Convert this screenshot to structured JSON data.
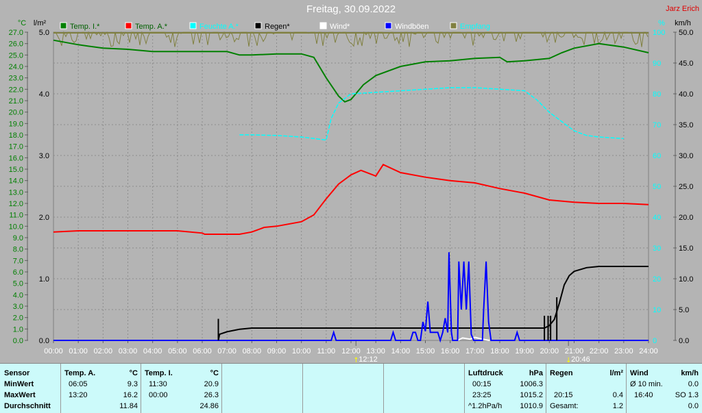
{
  "title": "Freitag, 30.09.2022",
  "author": "Jarz Erich",
  "chart_data": {
    "type": "line",
    "title": "Freitag, 30.09.2022",
    "axes": {
      "left_unit": "°C",
      "left_range": [
        0,
        27
      ],
      "left_ticks": [
        "0.0",
        "1.0",
        "2.0",
        "3.0",
        "4.0",
        "5.0",
        "6.0",
        "7.0",
        "8.0",
        "9.0",
        "10.0",
        "11.0",
        "12.0",
        "13.0",
        "14.0",
        "15.0",
        "16.0",
        "17.0",
        "18.0",
        "19.0",
        "20.0",
        "21.0",
        "22.0",
        "23.0",
        "24.0",
        "25.0",
        "26.0",
        "27.0"
      ],
      "rain_unit": "l/m²",
      "rain_range": [
        0,
        5
      ],
      "rain_ticks": [
        "0.0",
        "1.0",
        "2.0",
        "3.0",
        "4.0",
        "5.0"
      ],
      "pct_unit": "%",
      "pct_range": [
        0,
        100
      ],
      "pct_ticks": [
        "0",
        "10",
        "20",
        "30",
        "40",
        "50",
        "60",
        "70",
        "80",
        "90",
        "100"
      ],
      "wind_unit": "km/h",
      "wind_range": [
        0,
        50
      ],
      "wind_ticks": [
        "0.0",
        "5.0",
        "10.0",
        "15.0",
        "20.0",
        "25.0",
        "30.0",
        "35.0",
        "40.0",
        "45.0",
        "50.0"
      ],
      "x_ticks": [
        "00:00",
        "01:00",
        "02:00",
        "03:00",
        "04:00",
        "05:00",
        "06:00",
        "07:00",
        "08:00",
        "09:00",
        "10:00",
        "11:00",
        "12:00",
        "13:00",
        "14:00",
        "15:00",
        "16:00",
        "17:00",
        "18:00",
        "19:00",
        "20:00",
        "21:00",
        "22:00",
        "23:00",
        "24:00"
      ]
    },
    "markers": [
      {
        "time": "12:12",
        "hour": 12.2,
        "label": "12:12",
        "kind": "sunrise"
      },
      {
        "time": "20:46",
        "hour": 20.77,
        "label": "20:46",
        "kind": "sunset"
      }
    ],
    "series": [
      {
        "name": "Temp. I.*",
        "color": "#008000",
        "axis": "left",
        "points": [
          [
            0,
            26.3
          ],
          [
            1,
            25.9
          ],
          [
            2,
            25.6
          ],
          [
            3,
            25.5
          ],
          [
            4,
            25.3
          ],
          [
            5,
            25.3
          ],
          [
            6,
            25.3
          ],
          [
            7,
            25.3
          ],
          [
            7.5,
            25.0
          ],
          [
            8,
            25.0
          ],
          [
            9,
            25.1
          ],
          [
            10,
            25.1
          ],
          [
            10.5,
            24.8
          ],
          [
            11,
            23.0
          ],
          [
            11.5,
            21.4
          ],
          [
            11.75,
            20.9
          ],
          [
            12,
            21.1
          ],
          [
            12.5,
            22.4
          ],
          [
            13,
            23.2
          ],
          [
            14,
            24.0
          ],
          [
            15,
            24.4
          ],
          [
            16,
            24.5
          ],
          [
            17,
            24.7
          ],
          [
            18,
            24.8
          ],
          [
            18.3,
            24.4
          ],
          [
            19,
            24.5
          ],
          [
            20,
            24.7
          ],
          [
            20.5,
            25.2
          ],
          [
            21,
            25.6
          ],
          [
            22,
            26.0
          ],
          [
            23,
            25.7
          ],
          [
            24,
            25.2
          ]
        ]
      },
      {
        "name": "Temp. A.*",
        "color": "#ff0000",
        "axis": "left",
        "points": [
          [
            0,
            9.5
          ],
          [
            1,
            9.6
          ],
          [
            2,
            9.6
          ],
          [
            3,
            9.6
          ],
          [
            4,
            9.6
          ],
          [
            5,
            9.6
          ],
          [
            6,
            9.4
          ],
          [
            6.1,
            9.3
          ],
          [
            7,
            9.3
          ],
          [
            7.5,
            9.3
          ],
          [
            8,
            9.5
          ],
          [
            8.5,
            9.9
          ],
          [
            9,
            10.0
          ],
          [
            10,
            10.4
          ],
          [
            10.5,
            11.0
          ],
          [
            11,
            12.4
          ],
          [
            11.5,
            13.7
          ],
          [
            12,
            14.5
          ],
          [
            12.4,
            14.9
          ],
          [
            13,
            14.4
          ],
          [
            13.3,
            15.4
          ],
          [
            14,
            14.7
          ],
          [
            15,
            14.3
          ],
          [
            16,
            14.0
          ],
          [
            17,
            13.8
          ],
          [
            18,
            13.3
          ],
          [
            19,
            12.9
          ],
          [
            20,
            12.3
          ],
          [
            21,
            12.1
          ],
          [
            22,
            12.0
          ],
          [
            23,
            12.0
          ],
          [
            24,
            11.9
          ]
        ]
      },
      {
        "name": "Feuchte A.*",
        "color": "#00ffff",
        "axis": "pct",
        "points": [
          [
            7.5,
            66.7
          ],
          [
            8,
            66.7
          ],
          [
            9,
            66.5
          ],
          [
            10,
            66
          ],
          [
            11,
            65
          ],
          [
            11.2,
            72
          ],
          [
            11.5,
            77
          ],
          [
            12,
            80
          ],
          [
            13,
            80.5
          ],
          [
            14,
            81
          ],
          [
            15,
            81.5
          ],
          [
            16,
            82
          ],
          [
            17,
            82
          ],
          [
            18,
            81.5
          ],
          [
            19,
            81
          ],
          [
            19.5,
            78
          ],
          [
            20,
            74
          ],
          [
            20.5,
            71
          ],
          [
            21,
            68
          ],
          [
            21.5,
            66.5
          ],
          [
            22,
            66
          ],
          [
            23,
            65.5
          ]
        ]
      },
      {
        "name": "Regen*",
        "color": "#000000",
        "axis": "rain",
        "points": [
          [
            0,
            0
          ],
          [
            6.65,
            0
          ],
          [
            6.7,
            0.1
          ],
          [
            7,
            0.14
          ],
          [
            7.5,
            0.18
          ],
          [
            8,
            0.2
          ],
          [
            19.8,
            0.2
          ],
          [
            20,
            0.24
          ],
          [
            20.2,
            0.34
          ],
          [
            20.4,
            0.6
          ],
          [
            20.6,
            0.9
          ],
          [
            20.8,
            1.05
          ],
          [
            21,
            1.12
          ],
          [
            21.5,
            1.18
          ],
          [
            22,
            1.2
          ],
          [
            24,
            1.2
          ]
        ]
      },
      {
        "name": "Wind*",
        "color": "#ffffff",
        "axis": "wind",
        "points": [
          [
            16.3,
            0
          ],
          [
            16.5,
            0.4
          ],
          [
            16.8,
            0.2
          ],
          [
            17,
            0.5
          ],
          [
            17.3,
            0.2
          ],
          [
            17.6,
            0
          ]
        ]
      },
      {
        "name": "Windböen",
        "color": "#0000ff",
        "axis": "wind",
        "points": [
          [
            0,
            0
          ],
          [
            11.2,
            0
          ],
          [
            11.3,
            1.3
          ],
          [
            11.4,
            0
          ],
          [
            13.6,
            0
          ],
          [
            13.7,
            1.3
          ],
          [
            13.8,
            0
          ],
          [
            14.4,
            0
          ],
          [
            14.5,
            1.3
          ],
          [
            14.6,
            1.3
          ],
          [
            14.7,
            0
          ],
          [
            14.8,
            0
          ],
          [
            14.9,
            3
          ],
          [
            15.0,
            1.5
          ],
          [
            15.1,
            6.3
          ],
          [
            15.2,
            1.3
          ],
          [
            15.5,
            1.3
          ],
          [
            15.6,
            0
          ],
          [
            15.7,
            1.3
          ],
          [
            15.8,
            3.6
          ],
          [
            15.9,
            1.3
          ],
          [
            15.95,
            14.3
          ],
          [
            16.05,
            1.3
          ],
          [
            16.1,
            0
          ],
          [
            16.3,
            0
          ],
          [
            16.35,
            12.8
          ],
          [
            16.45,
            5
          ],
          [
            16.55,
            12.8
          ],
          [
            16.65,
            5
          ],
          [
            16.75,
            12.8
          ],
          [
            16.85,
            1
          ],
          [
            16.95,
            0
          ],
          [
            17.3,
            0
          ],
          [
            17.35,
            5
          ],
          [
            17.45,
            12.8
          ],
          [
            17.55,
            3
          ],
          [
            17.65,
            0
          ],
          [
            18.6,
            0
          ],
          [
            18.7,
            1.3
          ],
          [
            18.8,
            0
          ],
          [
            24,
            0
          ]
        ]
      }
    ],
    "empfang": {
      "name": "Empfang",
      "color": "#808040",
      "axis": "pct",
      "level": 100,
      "dip_min": 95
    }
  },
  "legend": [
    {
      "label": "Temp. I.*",
      "color": "#008000",
      "text_color": "#006000"
    },
    {
      "label": "Temp. A.*",
      "color": "#ff0000",
      "text_color": "#006000"
    },
    {
      "label": "Feuchte A.*",
      "color": "#00ffff",
      "text_color": "#00ffff"
    },
    {
      "label": "Regen*",
      "color": "#000000",
      "text_color": "#000000"
    },
    {
      "label": "Wind*",
      "color": "#ffffff",
      "text_color": "#ffffff"
    },
    {
      "label": "Windböen",
      "color": "#0000ff",
      "text_color": "#ffffff"
    },
    {
      "label": "Empfang",
      "color": "#808040",
      "text_color": "#00ffff"
    }
  ],
  "table": {
    "sensor": {
      "h": "Sensor",
      "r1": "MinWert",
      "r2": "MaxWert",
      "r3": "Durchschnitt"
    },
    "tempA": {
      "h": "Temp. A.",
      "u": "°C",
      "min_t": "06:05",
      "min": "9.3",
      "max_t": "13:20",
      "max": "16.2",
      "avg": "11.84"
    },
    "tempI": {
      "h": "Temp. I.",
      "u": "°C",
      "min_t": "11:30",
      "min": "20.9",
      "max_t": "00:00",
      "max": "26.3",
      "avg": "24.86"
    },
    "druck": {
      "h": "Luftdruck",
      "u": "hPa",
      "min_t": "00:15",
      "min": "1006.3",
      "max_t": "23:25",
      "max": "1015.2",
      "trend": "^1.2hPa/h",
      "avg": "1010.9"
    },
    "regen": {
      "h": "Regen",
      "u": "l/m²",
      "max_t": "20:15",
      "max": "0.4",
      "total_l": "Gesamt:",
      "total": "1.2"
    },
    "wind": {
      "h": "Wind",
      "u": "km/h",
      "r1_l": "Ø 10 min.",
      "r1": "0.0",
      "r2_t": "16:40",
      "r2": "SO 1.3",
      "r3": "0.0"
    }
  }
}
